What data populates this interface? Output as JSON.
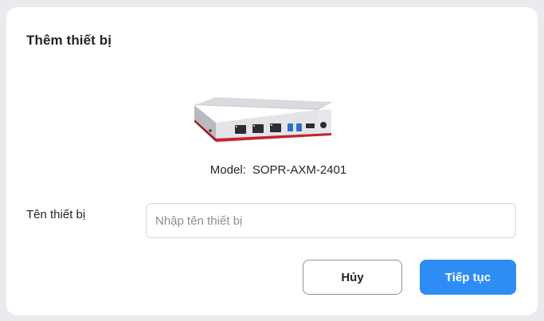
{
  "dialog": {
    "title": "Thêm thiết bị",
    "device_image_icon": "network-appliance-icon",
    "model_label": "Model:",
    "model_value": "SOPR-AXM-2401",
    "name_field": {
      "label": "Tên thiết bị",
      "value": "",
      "placeholder": "Nhập tên thiết bị"
    },
    "buttons": {
      "cancel_label": "Hủy",
      "next_label": "Tiếp tục"
    }
  },
  "colors": {
    "primary": "#2e8df5",
    "device_accent": "#c8222a",
    "background": "#e9ebef"
  }
}
